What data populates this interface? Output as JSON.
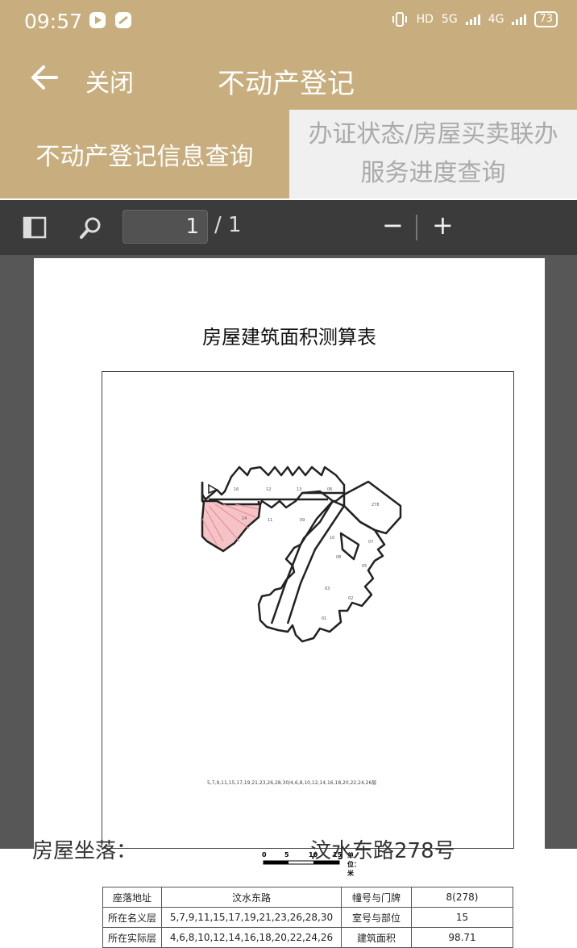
{
  "status_bar": {
    "time": "09:57",
    "right_labels": [
      "HD",
      "5G",
      "4G"
    ],
    "battery": "73"
  },
  "nav": {
    "close_label": "关闭",
    "title": "不动产登记"
  },
  "tabs": {
    "active_label": "不动产登记信息查询",
    "inactive_line1": "办证状态/房屋买卖联办",
    "inactive_line2": "服务进度查询"
  },
  "pdf_toolbar": {
    "current_page": "1",
    "total_pages": "/ 1",
    "zoom_out": "−",
    "zoom_in": "+"
  },
  "document": {
    "title": "房屋建筑面积测算表",
    "floor_list": "5,7,9,11,15,17,19,21,23,26,28,30/4,6,8,10,12,14,16,18,20,22,24,26层",
    "scale_labels": [
      "0",
      "5",
      "10",
      "15"
    ],
    "scale_unit": "单位：米",
    "room_labels": [
      "16",
      "12",
      "13",
      "06",
      "278",
      "14",
      "11",
      "09",
      "10",
      "07",
      "08",
      "05",
      "03",
      "02",
      "01"
    ],
    "table": {
      "row1": {
        "label1": "座落地址",
        "value1": "汶水东路",
        "label2": "幢号与门牌",
        "value2": "8(278)"
      },
      "row2": {
        "label1": "所在名义层",
        "value1": "5,7,9,11,15,17,19,21,23,26,28,30",
        "label2": "室号与部位",
        "value2": "15"
      },
      "row3": {
        "label1": "所在实际层",
        "value1": "4,6,8,10,12,14,16,18,20,22,24,26",
        "label2": "建筑面积",
        "value2": "98.71"
      }
    }
  },
  "below_page": {
    "left_text": "房屋坐落：",
    "right_text": "汶水东路278号"
  },
  "colors": {
    "brand": "#c8ae7e",
    "highlight": "#f5c3c6",
    "toolbar": "#3b3b3b"
  }
}
